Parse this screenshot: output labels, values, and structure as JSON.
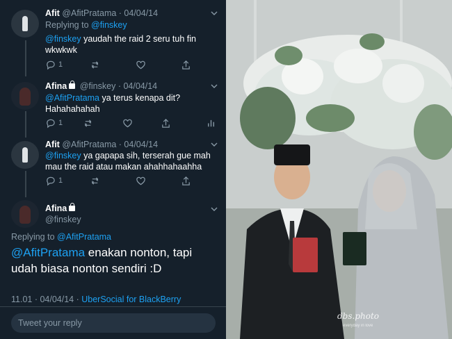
{
  "tweets": [
    {
      "name": "Afit",
      "handle": "@AfitPratama",
      "date": "· 04/04/14",
      "replying_prefix": "Replying to ",
      "replying_to": "@finskey",
      "body_mention": "@finskey",
      "body_text": " yaudah the raid 2 seru tuh fin wkwkwk",
      "replies": "1"
    },
    {
      "name": "Afina",
      "handle": "@finskey",
      "date": "· 04/04/14",
      "body_mention": "@AfitPratama",
      "body_text": " ya terus kenapa dit? Hahahahahah",
      "replies": "1"
    },
    {
      "name": "Afit",
      "handle": "@AfitPratama",
      "date": "· 04/04/14",
      "body_mention": "@finskey",
      "body_text": " ya gapapa sih, terserah gue mah mau the raid atau makan ahahhahaahha",
      "replies": "1"
    }
  ],
  "main_tweet": {
    "name": "Afina",
    "handle": "@finskey",
    "replying_prefix": "Replying to ",
    "replying_to": "@AfitPratama",
    "body_mention": "@AfitPratama",
    "body_text": " enakan nonton, tapi udah biasa nonton sendiri :D",
    "time_date": "11.01 · 04/04/14 · ",
    "source": "UberSocial for BlackBerry"
  },
  "reply_box": {
    "placeholder": "Tweet your reply"
  },
  "photo": {
    "watermark": "dbs.photo",
    "watermark_sub": "everyday in love"
  },
  "colors": {
    "background": "#15202b",
    "accent": "#1da1f2",
    "muted": "#8899a6",
    "text": "#ffffff"
  },
  "icons": [
    "reply-icon",
    "retweet-icon",
    "like-icon",
    "share-icon",
    "analytics-icon",
    "chevron-down-icon",
    "lock-icon"
  ]
}
